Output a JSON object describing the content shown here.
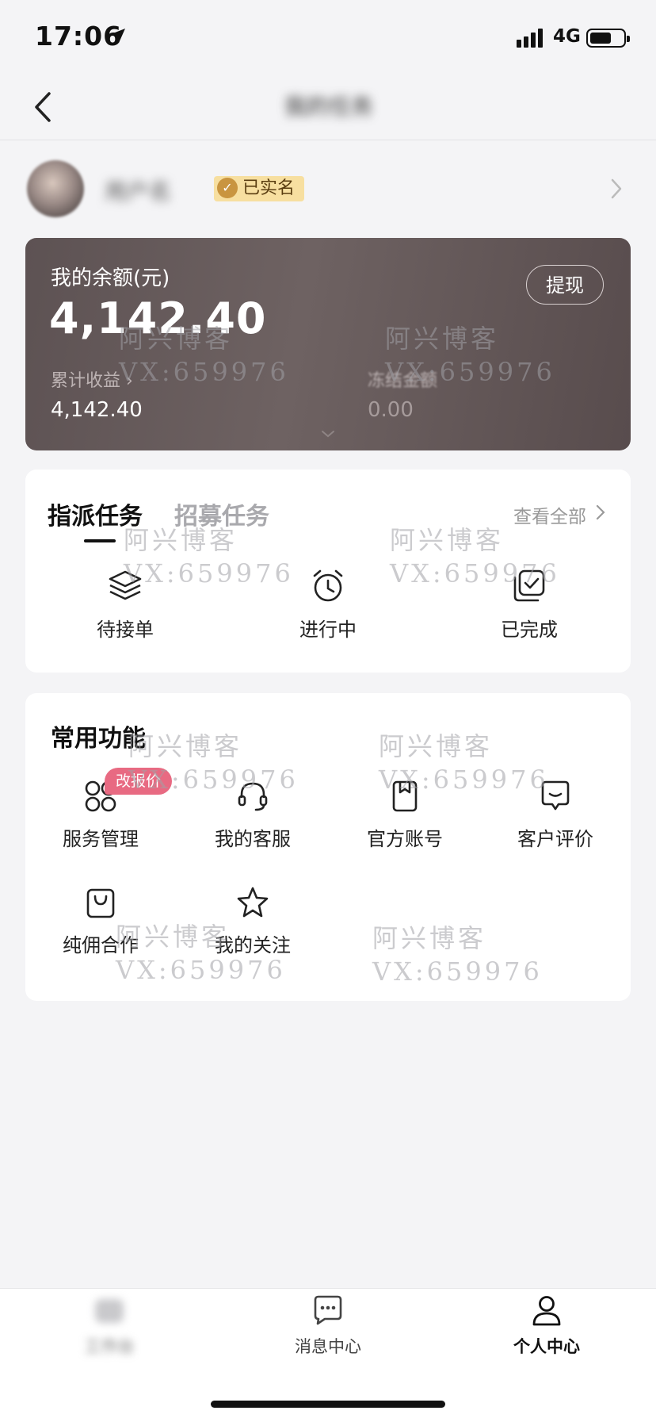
{
  "status_bar": {
    "time": "17:06",
    "network": "4G"
  },
  "nav": {
    "title": "我的任务"
  },
  "profile": {
    "name": "用户名",
    "verified_label": "已实名"
  },
  "balance": {
    "label": "我的余额(元)",
    "value": "4,142.40",
    "withdraw_label": "提现",
    "cumulative_label": "累计收益 ›",
    "cumulative_value": "4,142.40",
    "frozen_label": "冻结金额",
    "frozen_value": "0.00"
  },
  "tasks": {
    "tabs": [
      {
        "label": "指派任务",
        "active": true
      },
      {
        "label": "招募任务",
        "active": false
      }
    ],
    "view_all": "查看全部",
    "items": [
      {
        "label": "待接单",
        "icon": "layers-icon"
      },
      {
        "label": "进行中",
        "icon": "alarm-clock-icon"
      },
      {
        "label": "已完成",
        "icon": "check-square-icon"
      }
    ]
  },
  "functions": {
    "title": "常用功能",
    "badge": "改报价",
    "items": [
      {
        "label": "服务管理",
        "icon": "grid-icon"
      },
      {
        "label": "我的客服",
        "icon": "headset-icon"
      },
      {
        "label": "官方账号",
        "icon": "bookmark-icon"
      },
      {
        "label": "客户评价",
        "icon": "comment-icon"
      },
      {
        "label": "纯佣合作",
        "icon": "bag-icon"
      },
      {
        "label": "我的关注",
        "icon": "star-icon"
      }
    ]
  },
  "watermark": {
    "line1": "阿兴博客",
    "line2": "VX:659976"
  },
  "tabbar": {
    "items": [
      {
        "label": "工作台",
        "icon": "home-icon",
        "active": false
      },
      {
        "label": "消息中心",
        "icon": "message-icon",
        "active": false
      },
      {
        "label": "个人中心",
        "icon": "user-icon",
        "active": true
      }
    ]
  }
}
